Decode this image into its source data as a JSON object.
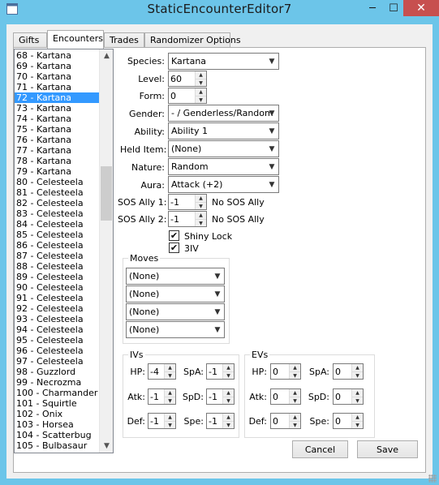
{
  "window": {
    "title": "StaticEncounterEditor7",
    "buttons": {
      "minimize": "─",
      "maximize": "☐",
      "close": "✕"
    }
  },
  "tabs": [
    "Gifts",
    "Encounters",
    "Trades",
    "Randomizer Options"
  ],
  "selected_tab": "Encounters",
  "encounter_list": {
    "items": [
      "68 - Kartana",
      "69 - Kartana",
      "70 - Kartana",
      "71 - Kartana",
      "72 - Kartana",
      "73 - Kartana",
      "74 - Kartana",
      "75 - Kartana",
      "76 - Kartana",
      "77 - Kartana",
      "78 - Kartana",
      "79 - Kartana",
      "80 - Celesteela",
      "81 - Celesteela",
      "82 - Celesteela",
      "83 - Celesteela",
      "84 - Celesteela",
      "85 - Celesteela",
      "86 - Celesteela",
      "87 - Celesteela",
      "88 - Celesteela",
      "89 - Celesteela",
      "90 - Celesteela",
      "91 - Celesteela",
      "92 - Celesteela",
      "93 - Celesteela",
      "94 - Celesteela",
      "95 - Celesteela",
      "96 - Celesteela",
      "97 - Celesteela",
      "98 - Guzzlord",
      "99 - Necrozma",
      "100 - Charmander",
      "101 - Squirtle",
      "102 - Onix",
      "103 - Horsea",
      "104 - Scatterbug",
      "105 - Bulbasaur"
    ],
    "selected_index": 4
  },
  "fields": {
    "species": {
      "label": "Species:",
      "value": "Kartana"
    },
    "level": {
      "label": "Level:",
      "value": "60"
    },
    "form": {
      "label": "Form:",
      "value": "0"
    },
    "gender": {
      "label": "Gender:",
      "value": "- / Genderless/Random"
    },
    "ability": {
      "label": "Ability:",
      "value": "Ability 1"
    },
    "held_item": {
      "label": "Held Item:",
      "value": "(None)"
    },
    "nature": {
      "label": "Nature:",
      "value": "Random"
    },
    "aura": {
      "label": "Aura:",
      "value": "Attack (+2)"
    },
    "sos_ally_1": {
      "label": "SOS Ally 1:",
      "value": "-1",
      "desc": "No SOS Ally"
    },
    "sos_ally_2": {
      "label": "SOS Ally 2:",
      "value": "-1",
      "desc": "No SOS Ally"
    }
  },
  "checkboxes": {
    "shiny_lock": {
      "label": "Shiny Lock",
      "checked": true
    },
    "three_iv": {
      "label": "3IV",
      "checked": true
    }
  },
  "check_glyph": "✔",
  "moves": {
    "title": "Moves",
    "values": [
      "(None)",
      "(None)",
      "(None)",
      "(None)"
    ]
  },
  "ivs": {
    "title": "IVs",
    "hp": {
      "label": "HP:",
      "value": "-4"
    },
    "atk": {
      "label": "Atk:",
      "value": "-1"
    },
    "def": {
      "label": "Def:",
      "value": "-1"
    },
    "spa": {
      "label": "SpA:",
      "value": "-1"
    },
    "spd": {
      "label": "SpD:",
      "value": "-1"
    },
    "spe": {
      "label": "Spe:",
      "value": "-1"
    }
  },
  "evs": {
    "title": "EVs",
    "hp": {
      "label": "HP:",
      "value": "0"
    },
    "atk": {
      "label": "Atk:",
      "value": "0"
    },
    "def": {
      "label": "Def:",
      "value": "0"
    },
    "spa": {
      "label": "SpA:",
      "value": "0"
    },
    "spd": {
      "label": "SpD:",
      "value": "0"
    },
    "spe": {
      "label": "Spe:",
      "value": "0"
    }
  },
  "actions": {
    "cancel": "Cancel",
    "save": "Save"
  },
  "icons": {
    "dropdown": "chevron-down-icon",
    "spin": "spin-arrows-icon",
    "app": "app-icon"
  },
  "colors": {
    "title_bar": "#6cc5e9",
    "close_button": "#c7504f",
    "selection": "#3399ff"
  }
}
